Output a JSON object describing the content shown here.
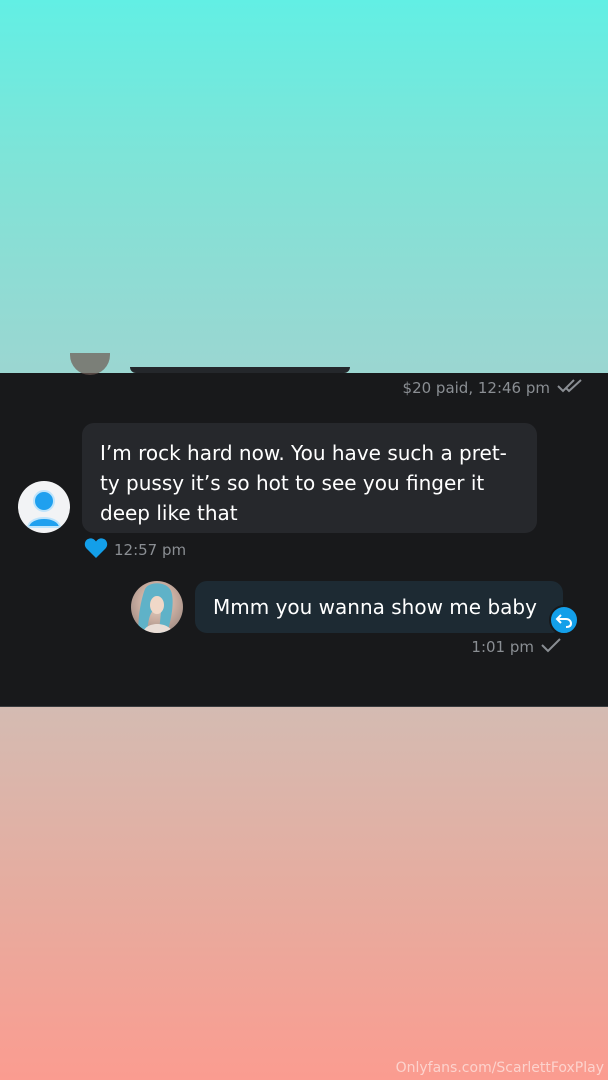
{
  "colors": {
    "accent": "#139fe9",
    "chat_background": "#18191b",
    "incoming_bubble": "#26282c",
    "outgoing_bubble": "#1d2a33",
    "meta_text": "#8a8e93"
  },
  "messages": [
    {
      "direction": "outgoing",
      "meta": "$20 paid, 12:46 pm",
      "status_icon": "double-check-icon"
    },
    {
      "direction": "incoming",
      "text_lines": [
        "I’m rock hard now. You have such a pret-",
        "ty pussy it’s so hot to see you finger it",
        "deep like that"
      ],
      "time": "12:57 pm",
      "reaction_icon": "heart-icon",
      "avatar_icon": "default-user-avatar-icon"
    },
    {
      "direction": "outgoing",
      "text": "Mmm you wanna show me baby",
      "time": "1:01 pm",
      "status_icon": "check-icon",
      "action_icon": "undo-icon"
    }
  ],
  "watermark": "Onlyfans.com/ScarlettFoxPlay"
}
